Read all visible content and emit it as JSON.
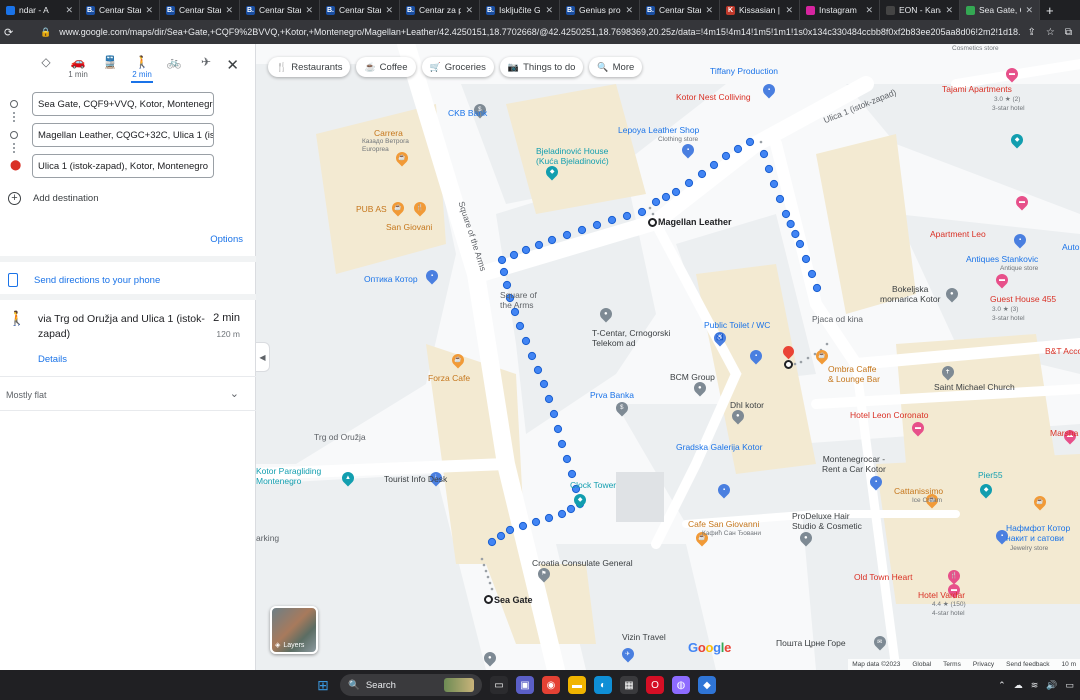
{
  "browser": {
    "tabs": [
      {
        "label": "ndar - A",
        "fav": "",
        "color": "#1a73e8"
      },
      {
        "label": "Centar Staroc",
        "fav": "B.",
        "color": "#1a4fa3"
      },
      {
        "label": "Centar Staroc",
        "fav": "B.",
        "color": "#1a4fa3"
      },
      {
        "label": "Centar Staroc",
        "fav": "B.",
        "color": "#1a4fa3"
      },
      {
        "label": "Centar Staroc",
        "fav": "B.",
        "color": "#1a4fa3"
      },
      {
        "label": "Centar za po",
        "fav": "B.",
        "color": "#1a4fa3"
      },
      {
        "label": "Isključite Gen",
        "fav": "B.",
        "color": "#1a4fa3"
      },
      {
        "label": "Genius progr",
        "fav": "B.",
        "color": "#1a4fa3"
      },
      {
        "label": "Centar Staroc",
        "fav": "B.",
        "color": "#1a4fa3"
      },
      {
        "label": "Kissasian | W",
        "fav": "K",
        "color": "#c0392b"
      },
      {
        "label": "Instagram",
        "fav": "",
        "color": "#d6249f"
      },
      {
        "label": "EON - Kanali",
        "fav": "",
        "color": "#444"
      },
      {
        "label": "Sea Gate, CQ",
        "fav": "",
        "color": "#34a853"
      }
    ],
    "new_tab": "+",
    "url": "www.google.com/maps/dir/Sea+Gate,+CQF9%2BVVQ,+Kotor,+Montenegro/Magellan+Leather/42.4250151,18.7702668/@42.4250251,18.7698369,20.25z/data=!4m15!4m14!1m5!1m1!1s0x134c330484ccbb8f0xf2b83ee205aa8d06!2m2!1d18.7697448!2d42.424713"
  },
  "directions": {
    "modes": [
      {
        "icon": "best-route-icon",
        "glyph": "◇",
        "time": ""
      },
      {
        "icon": "car-icon",
        "glyph": "🚗",
        "time": "1 min"
      },
      {
        "icon": "transit-icon",
        "glyph": "🚆",
        "time": ""
      },
      {
        "icon": "walking-icon",
        "glyph": "🚶",
        "time": "2 min"
      },
      {
        "icon": "cycling-icon",
        "glyph": "🚲",
        "time": ""
      },
      {
        "icon": "flight-icon",
        "glyph": "✈",
        "time": ""
      }
    ],
    "close": "✕",
    "waypoints": [
      "Sea Gate, CQF9+VVQ, Kotor, Montenegro",
      "Magellan Leather, CQGC+32C, Ulica 1 (istok-zapad)",
      "Ulica 1 (istok-zapad), Kotor, Montenegro"
    ],
    "add_destination": "Add destination",
    "options": "Options",
    "send_to_phone": "Send directions to your phone",
    "route": {
      "via": "via Trg od Oružja and Ulica 1 (istok-zapad)",
      "duration": "2 min",
      "distance": "120 m",
      "details": "Details"
    },
    "terrain": "Mostly flat"
  },
  "map": {
    "chips": [
      {
        "icon": "restaurant-icon",
        "glyph": "🍴",
        "label": "Restaurants"
      },
      {
        "icon": "coffee-icon",
        "glyph": "☕",
        "label": "Coffee"
      },
      {
        "icon": "groceries-icon",
        "glyph": "🛒",
        "label": "Groceries"
      },
      {
        "icon": "things-to-do-icon",
        "glyph": "📷",
        "label": "Things to do"
      },
      {
        "icon": "search-icon",
        "glyph": "🔍",
        "label": "More"
      }
    ],
    "places": {
      "ckb_bank": "CKB Bank",
      "carrera": "Carrera",
      "carrera_sub": "Казадо Ветрога\nEuroprea",
      "pub_as": "PUB AS",
      "san_giovani": "San Giovani",
      "optika": "Оптика Котор",
      "square_of_the_arms": "Square of\nthe Arms",
      "forza": "Forza Cafe",
      "trg": "Trg od Oružja",
      "paragliding": "Kotor Paragliding\nMontenegro",
      "tourist_info": "Tourist Info Desk",
      "clock_tower": "Clock Tower",
      "croatia": "Croatia Consulate General",
      "sea_gate": "Sea Gate",
      "vizin": "Vizin Travel",
      "parking": "arking",
      "tiffany": "Tiffany Production",
      "kotor_nest": "Kotor Nest Colliving",
      "lepoya": "Lepoya Leather Shop",
      "lepoya_sub": "Clothing store",
      "bjeladinovic": "Bjeladinović House\n(Kuća Bjeladinović)",
      "magellan": "Magellan Leather",
      "t_centar": "T-Centar, Crnogorski\nTelekom ad",
      "public_toilet": "Public Toilet / WC",
      "bcm": "BCM Group",
      "prva_banka": "Prva Banka",
      "dhl": "Dhl kotor",
      "gradska": "Gradska Galerija Kotor",
      "cafe_san": "Cafe San Giovanni",
      "cafe_san_sub": "Кафић Сан Ђовани",
      "posta": "Пошта Црне Горе",
      "tajami": "Tajami Apartments",
      "tajami_rating": "3.0 ★ (2)",
      "tajami_sub": "3-star hotel",
      "cosmetics": "Cosmetics store",
      "ulica": "Ulica 1 (istok-zapad)",
      "apartment_leo": "Apartment Leo",
      "antiques": "Antiques Stankovic",
      "antiques_sub": "Antique store",
      "bokeljska": "Bokeljska\nmornarica Kotor",
      "guest_house": "Guest House 455",
      "guest_rating": "3.0 ★ (3)",
      "guest_sub": "3-star hotel",
      "pjaca": "Pjaca od kina",
      "bt": "B&T Acco",
      "ombra": "Ombra Caffe\n& Lounge Bar",
      "saint_michael": "Saint Michael Church",
      "hotel_leon": "Hotel Leon Coronato",
      "montenegrocar": "Montenegrocar -\nRent a Car Kotor",
      "marsha": "Marsha",
      "cattanissimo": "Cattanissimo",
      "cattanissimo_sub": "Ice Cream",
      "pier55": "Pier55",
      "prodeluxe": "ProDeluxe Hair\nStudio & Cosmetic",
      "namfot": "Нафмфот Котор\nнакит и сатови",
      "namfot_sub": "Jewelry store",
      "old_town": "Old Town Heart",
      "hotel_vardar": "Hotel Vardar",
      "vardar_rating": "4.4 ★ (150)",
      "vardar_sub": "4-star hotel",
      "auto": "Auto",
      "square_street": "Square of the Arms"
    },
    "layers": "Layers",
    "google": [
      "G",
      "o",
      "o",
      "g",
      "l",
      "e"
    ],
    "google_colors": [
      "#4285f4",
      "#ea4335",
      "#fbbc05",
      "#4285f4",
      "#34a853",
      "#ea4335"
    ],
    "attribution": [
      "Map data ©2023",
      "Global",
      "Terms",
      "Privacy",
      "Send feedback",
      "10 m"
    ]
  },
  "taskbar": {
    "search": "Search",
    "apps": [
      {
        "icon": "windows-start-icon",
        "glyph": "⊞",
        "color": "#3a96dd"
      },
      {
        "icon": "task-view-icon",
        "glyph": "▭",
        "color": "#2b2b2e"
      },
      {
        "icon": "teams-icon",
        "glyph": "▣",
        "color": "#5b5fc7"
      },
      {
        "icon": "chrome-icon",
        "glyph": "◉",
        "color": "#e44134"
      },
      {
        "icon": "file-explorer-icon",
        "glyph": "▬",
        "color": "#f0b400"
      },
      {
        "icon": "edge-icon",
        "glyph": "◐",
        "color": "#0f8fd6"
      },
      {
        "icon": "store-icon",
        "glyph": "▦",
        "color": "#3a3a3d"
      },
      {
        "icon": "opera-icon",
        "glyph": "O",
        "color": "#d50f25"
      },
      {
        "icon": "app-icon",
        "glyph": "◍",
        "color": "#8d6bff"
      },
      {
        "icon": "app2-icon",
        "glyph": "◆",
        "color": "#2f75d6"
      }
    ]
  },
  "colors": {
    "route_blue": "#4285f4",
    "pin_red": "#ea4335",
    "hotel_pink": "#e7508a",
    "food_orange": "#f19a37",
    "shop_blue": "#4a7fe0",
    "poi_gray": "#7e8a94",
    "teal": "#129eaf"
  }
}
